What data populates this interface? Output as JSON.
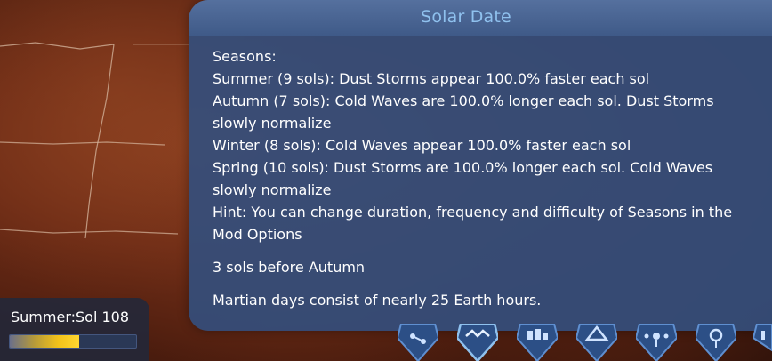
{
  "tooltip": {
    "title": "Solar Date",
    "lines": [
      "Seasons:",
      "Summer (9 sols): Dust Storms appear 100.0% faster each sol",
      "Autumn (7 sols): Cold Waves are 100.0% longer each sol. Dust Storms",
      "slowly normalize",
      "Winter (8 sols): Cold Waves appear 100.0% faster each sol",
      "Spring (10 sols): Dust Storms are 100.0% longer each sol. Cold Waves",
      "slowly normalize",
      "Hint: You can change duration, frequency and difficulty of Seasons in the",
      "Mod Options"
    ],
    "countdown": "3 sols before Autumn",
    "fact": "Martian days consist of nearly 25 Earth hours."
  },
  "sol_panel": {
    "label": "Summer:Sol 108",
    "day_progress": 0.55
  },
  "build_menu": {
    "icons": [
      "infrastructure-icon",
      "terraforming-icon",
      "production-icon",
      "habitats-icon",
      "power-icon",
      "decorations-icon",
      "storage-icon"
    ]
  },
  "colors": {
    "tooltip_bg": "#344e7c",
    "title": "#8fc1ee",
    "progress": "#ffd730"
  }
}
